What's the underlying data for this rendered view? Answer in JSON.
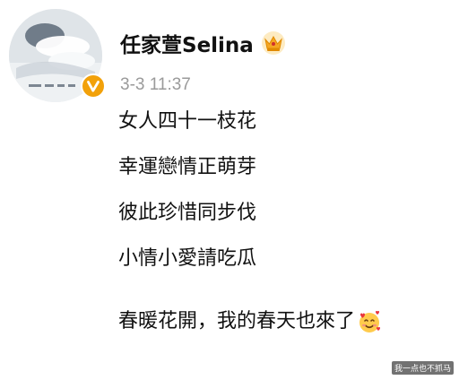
{
  "post": {
    "author": {
      "name": "任家萱Selina",
      "avatar_icon": "avatar-photo",
      "verified_icon": "verified-v-icon",
      "member_icon": "crown-icon"
    },
    "timestamp": "3-3 11:37",
    "lines": [
      "女人四十一枝花",
      "幸運戀情正萌芽",
      "彼此珍惜同步伐",
      "小情小愛請吃瓜"
    ],
    "last_line": "春暖花開，我的春天也來了",
    "last_line_emoji": "smiling-face-with-hearts-icon"
  },
  "watermark": "我一点也不抓马",
  "colors": {
    "name": "#111111",
    "timestamp": "#9a9a9a",
    "verified_badge": "#f2a10a",
    "crown": "#f5a623"
  }
}
